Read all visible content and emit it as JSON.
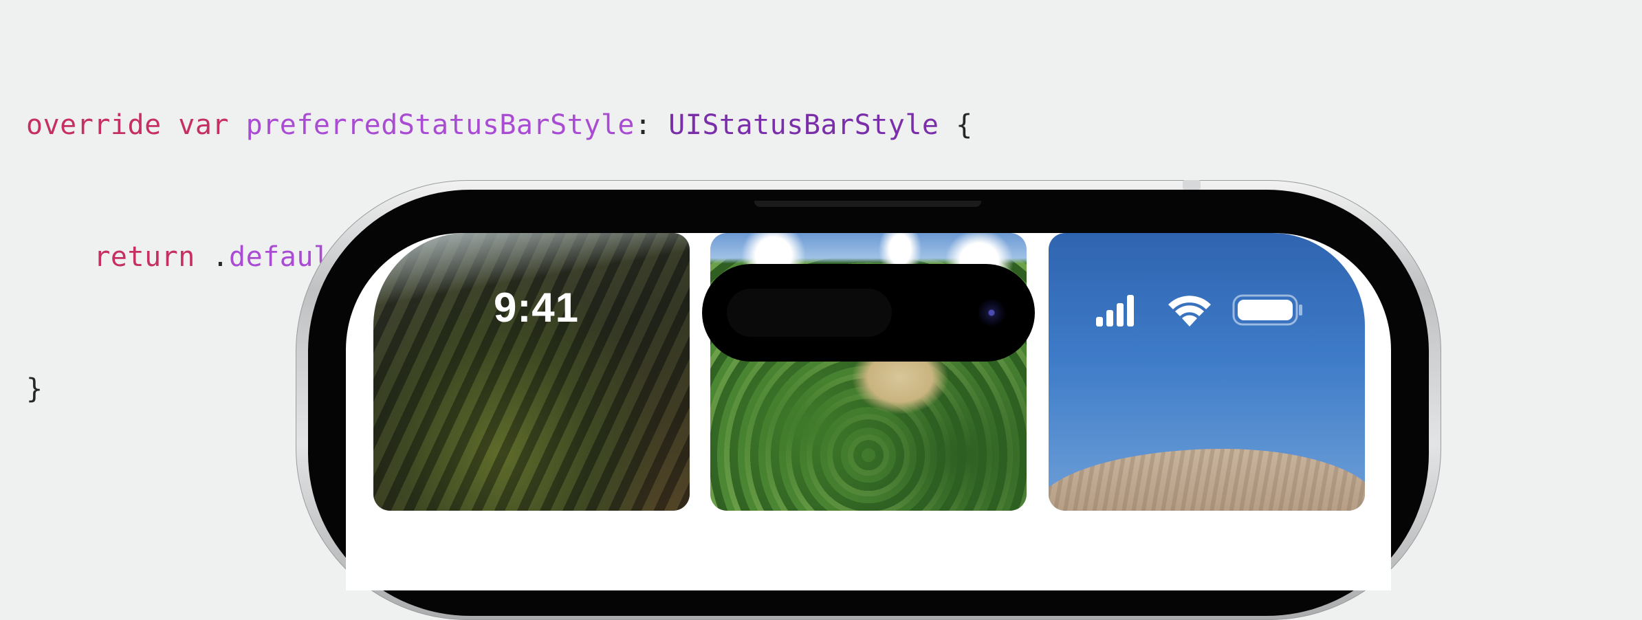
{
  "code": {
    "line1": {
      "kw1": "override",
      "kw2": "var",
      "property": "preferredStatusBarStyle",
      "colon": ":",
      "type": "UIStatusBarStyle",
      "brace": "{"
    },
    "line2": {
      "kw": "return",
      "dot": ".",
      "value": "default"
    },
    "line3": {
      "brace": "}"
    }
  },
  "status_bar": {
    "time": "9:41",
    "icons": [
      "cellular-signal-icon",
      "wifi-icon",
      "battery-icon"
    ],
    "style": "light-content-white"
  },
  "colors": {
    "keyword": "#c62f61",
    "property": "#a94bd3",
    "type": "#7a2ea9",
    "background": "#eff0f0"
  }
}
